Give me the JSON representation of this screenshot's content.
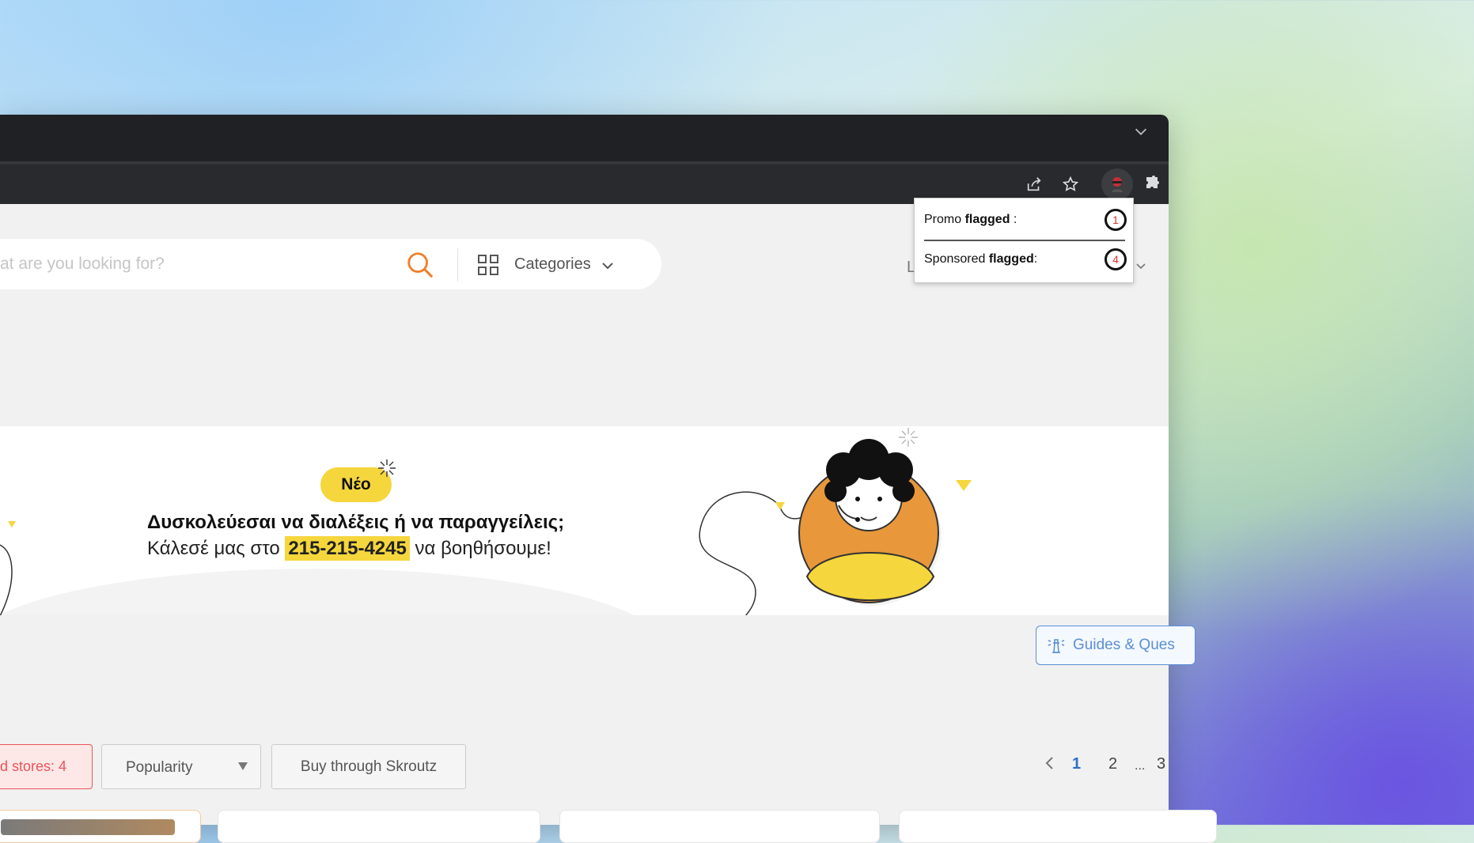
{
  "browser": {
    "toolbar_icons": [
      "share-icon",
      "star-icon",
      "extension-avatar-icon",
      "puzzle-icon"
    ]
  },
  "header": {
    "search_placeholder": "What are you looking for?",
    "search_placeholder_visible": "at are you looking for?",
    "categories_label": "Categories",
    "login_fragment": "L"
  },
  "banner": {
    "badge": "Νέο",
    "title": "Δυσκολεύεσαι να διαλέξεις ή να παραγγείλεις;",
    "line2_prefix": "Κάλεσέ μας στο",
    "phone": "215-215-4245",
    "line2_suffix": "να βοηθήσουμε!",
    "accent_color": "#f5d63d"
  },
  "guides": {
    "label": "Guides & Ques"
  },
  "filters": {
    "stores_label": "d stores: 4",
    "sort_selected": "Popularity",
    "buy_label": "Buy through Skroutz"
  },
  "pagination": {
    "current": "1",
    "next": "2",
    "ellipsis": "...",
    "last": "3"
  },
  "popup": {
    "promo_prefix": "Promo ",
    "promo_bold": "flagged",
    "promo_suffix": " :",
    "promo_count": "1",
    "sponsored_prefix": "Sponsored ",
    "sponsored_bold": "flagged",
    "sponsored_suffix": ":",
    "sponsored_count": "4"
  }
}
